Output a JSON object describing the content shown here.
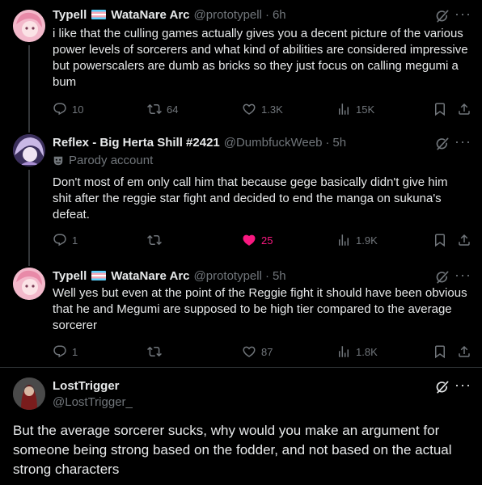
{
  "tweets": [
    {
      "name": "Typell",
      "name_suffix": "WataNare Arc",
      "handle": "@prototypell",
      "time": "6h",
      "text": "i like that the culling games actually gives you a decent picture of the various power levels of sorcerers and what kind of abilities are considered impressive but powerscalers are dumb as bricks so they just focus on calling megumi a bum",
      "replies": "10",
      "reposts": "64",
      "likes": "1.3K",
      "views": "15K"
    },
    {
      "name": "Reflex - Big Herta Shill #2421",
      "handle": "@DumbfuckWeeb",
      "time": "5h",
      "badge": "Parody account",
      "text": "Don't most of em only call him that because gege basically didn't give him shit after the reggie star fight and decided to end the manga on sukuna's defeat.",
      "replies": "1",
      "reposts": "",
      "likes": "25",
      "views": "1.9K"
    },
    {
      "name": "Typell",
      "name_suffix": "WataNare Arc",
      "handle": "@prototypell",
      "time": "5h",
      "text": "Well yes but even at the point of the Reggie fight it should have been obvious that he and Megumi are supposed to be high tier compared to the average sorcerer",
      "replies": "1",
      "reposts": "",
      "likes": "87",
      "views": "1.8K"
    }
  ],
  "main_tweet": {
    "name": "LostTrigger",
    "handle": "@LostTrigger_",
    "text": "But the average sorcerer sucks, why would you make an argument for someone being strong based on the fodder, and not based on the actual strong characters"
  },
  "separator": "·",
  "colors": {
    "background": "#000000",
    "muted": "#71767b",
    "like": "#f91880",
    "text": "#e7e9ea"
  }
}
